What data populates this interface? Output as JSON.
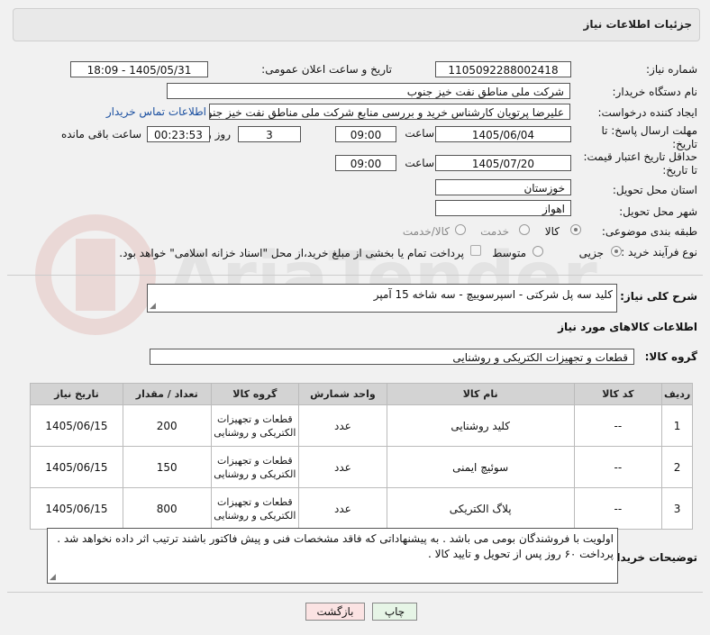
{
  "header": {
    "title": "جزئیات اطلاعات نیاز"
  },
  "fields": {
    "need_number_label": "شماره نیاز:",
    "need_number": "1105092288002418",
    "announce_label": "تاریخ و ساعت اعلان عمومی:",
    "announce_value": "1405/05/31 - 18:09",
    "buyer_label": "نام دستگاه خریدار:",
    "buyer_value": "شرکت ملی مناطق نفت خیز جنوب",
    "creator_label": "ایجاد کننده درخواست:",
    "creator_value": "علیرضا  پرتویان  کارشناس خرید و بررسی منابع  شرکت ملی مناطق نفت خیز جنوب",
    "contact_link": "اطلاعات تماس خریدار",
    "deadline_label_1": "مهلت ارسال پاسخ: تا",
    "deadline_label_2": "تاریخ:",
    "deadline_date": "1405/06/04",
    "time_label": "ساعت",
    "deadline_time": "09:00",
    "days_value": "3",
    "days_label": "روز و",
    "remaining_value": "00:23:53",
    "remaining_label": "ساعت باقی مانده",
    "validity_label_1": "حداقل تاریخ اعتبار قیمت:",
    "validity_label_2": "تا تاریخ:",
    "validity_date": "1405/07/20",
    "validity_time_label": "ساعت",
    "validity_time": "09:00",
    "province_label": "استان محل تحویل:",
    "province_value": "خوزستان",
    "city_label": "شهر محل تحویل:",
    "city_value": "اهواز",
    "category_label": "طبقه بندی موضوعی:",
    "category_options": [
      "کالا",
      "خدمت",
      "کالا/خدمت"
    ],
    "category_selected": "کالا",
    "process_label": "نوع فرآیند خرید :",
    "process_options": [
      "جزیی",
      "متوسط"
    ],
    "process_selected": "جزیی",
    "payment_note": "پرداخت تمام یا بخشی از مبلغ خرید،از محل \"اسناد خزانه اسلامی\" خواهد بود."
  },
  "summary": {
    "label": "شرح کلی نیاز:",
    "value": "کلید سه پل شرکتی - اسپرسوییچ - سه شاخه 15 آمپر"
  },
  "goods_section": {
    "title": "اطلاعات کالاهای مورد نیاز",
    "group_label": "گروه کالا:",
    "group_value": "قطعات و تجهیزات الکتریکی و روشنایی"
  },
  "table": {
    "headers": [
      "ردیف",
      "کد کالا",
      "نام کالا",
      "واحد شمارش",
      "گروه کالا",
      "تعداد / مقدار",
      "تاریخ نیاز"
    ],
    "rows": [
      {
        "index": "1",
        "code": "--",
        "name": "کلید روشنایی",
        "unit": "عدد",
        "group": "قطعات و تجهیزات الکتریکی و روشنایی",
        "qty": "200",
        "date": "1405/06/15"
      },
      {
        "index": "2",
        "code": "--",
        "name": "سوئیچ ایمنی",
        "unit": "عدد",
        "group": "قطعات و تجهیزات الکتریکی و روشنایی",
        "qty": "150",
        "date": "1405/06/15"
      },
      {
        "index": "3",
        "code": "--",
        "name": "پلاگ الکتریکی",
        "unit": "عدد",
        "group": "قطعات و تجهیزات الکتریکی و روشنایی",
        "qty": "800",
        "date": "1405/06/15"
      }
    ]
  },
  "buyer_notes": {
    "label": "توضیحات خریدار:",
    "value": "اولویت با فروشندگان بومی می باشد . به پیشنهاداتی که فاقد مشخصات فنی و پیش فاکتور باشند ترتیب اثر داده نخواهد شد . پرداخت ۶۰ روز پس از تحویل و تایید کالا ."
  },
  "buttons": {
    "print": "چاپ",
    "back": "بازگشت"
  },
  "watermark": "AriaTender.net",
  "colors": {
    "link": "#1a4fa0",
    "back_button_bg": "#fbe3e3",
    "print_button_bg": "#e6f5e6",
    "table_header_bg": "#d3d3d3",
    "watermark": "#c0392b"
  }
}
